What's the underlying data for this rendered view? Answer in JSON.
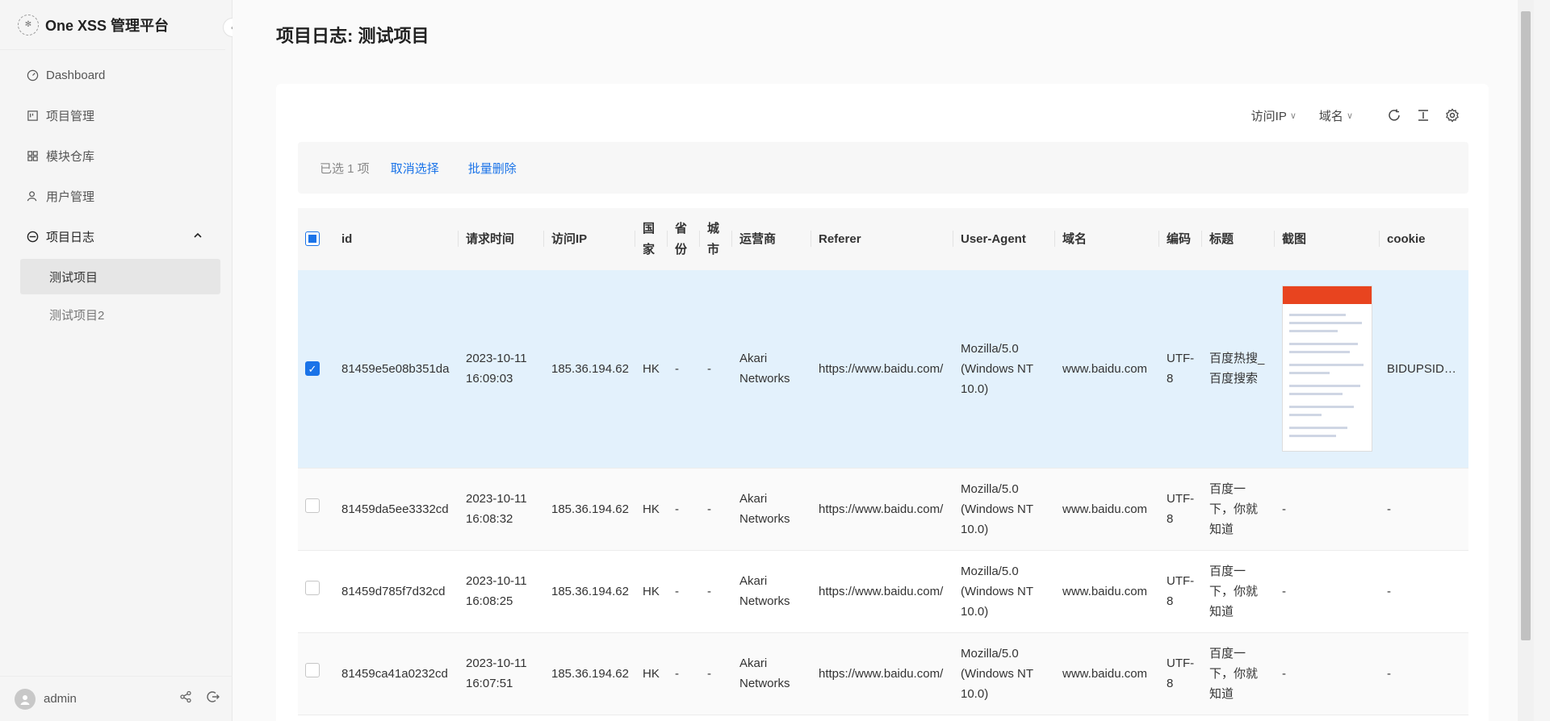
{
  "app": {
    "title": "One XSS 管理平台"
  },
  "sidebar": {
    "items": [
      {
        "label": "Dashboard",
        "icon": "dashboard-icon"
      },
      {
        "label": "项目管理",
        "icon": "project-icon"
      },
      {
        "label": "模块仓库",
        "icon": "module-icon"
      },
      {
        "label": "用户管理",
        "icon": "user-icon"
      },
      {
        "label": "项目日志",
        "icon": "log-icon"
      }
    ],
    "sub_items": [
      "测试项目",
      "测试项目2"
    ],
    "user": {
      "name": "admin"
    }
  },
  "page": {
    "title": "项目日志: 测试项目"
  },
  "toolbar": {
    "filter_ip": "访问IP",
    "filter_domain": "域名"
  },
  "selection": {
    "count_text": "已选 1 项",
    "cancel": "取消选择",
    "batch_delete": "批量删除"
  },
  "table": {
    "columns": [
      "id",
      "请求时间",
      "访问IP",
      "国家",
      "省份",
      "城市",
      "运营商",
      "Referer",
      "User-Agent",
      "域名",
      "编码",
      "标题",
      "截图",
      "cookie"
    ],
    "rows": [
      {
        "checked": true,
        "id": "81459e5e08b351da",
        "time": "2023-10-11 16:09:03",
        "ip": "185.36.194.62",
        "country": "HK",
        "province": "-",
        "city": "-",
        "isp": "Akari Networks",
        "referer": "https://www.baidu.com/",
        "ua": "Mozilla/5.0 (Windows NT 10.0)",
        "domain": "www.baidu.com",
        "encoding": "UTF-8",
        "title": "百度热搜_百度搜索",
        "screenshot": true,
        "cookie": "BIDUPSID=A..."
      },
      {
        "checked": false,
        "id": "81459da5ee3332cd",
        "time": "2023-10-11 16:08:32",
        "ip": "185.36.194.62",
        "country": "HK",
        "province": "-",
        "city": "-",
        "isp": "Akari Networks",
        "referer": "https://www.baidu.com/",
        "ua": "Mozilla/5.0 (Windows NT 10.0)",
        "domain": "www.baidu.com",
        "encoding": "UTF-8",
        "title": "百度一下，你就知道",
        "screenshot": false,
        "cookie": "-"
      },
      {
        "checked": false,
        "id": "81459d785f7d32cd",
        "time": "2023-10-11 16:08:25",
        "ip": "185.36.194.62",
        "country": "HK",
        "province": "-",
        "city": "-",
        "isp": "Akari Networks",
        "referer": "https://www.baidu.com/",
        "ua": "Mozilla/5.0 (Windows NT 10.0)",
        "domain": "www.baidu.com",
        "encoding": "UTF-8",
        "title": "百度一下，你就知道",
        "screenshot": false,
        "cookie": "-"
      },
      {
        "checked": false,
        "id": "81459ca41a0232cd",
        "time": "2023-10-11 16:07:51",
        "ip": "185.36.194.62",
        "country": "HK",
        "province": "-",
        "city": "-",
        "isp": "Akari Networks",
        "referer": "https://www.baidu.com/",
        "ua": "Mozilla/5.0 (Windows NT 10.0)",
        "domain": "www.baidu.com",
        "encoding": "UTF-8",
        "title": "百度一下，你就知道",
        "screenshot": false,
        "cookie": "-"
      }
    ]
  }
}
